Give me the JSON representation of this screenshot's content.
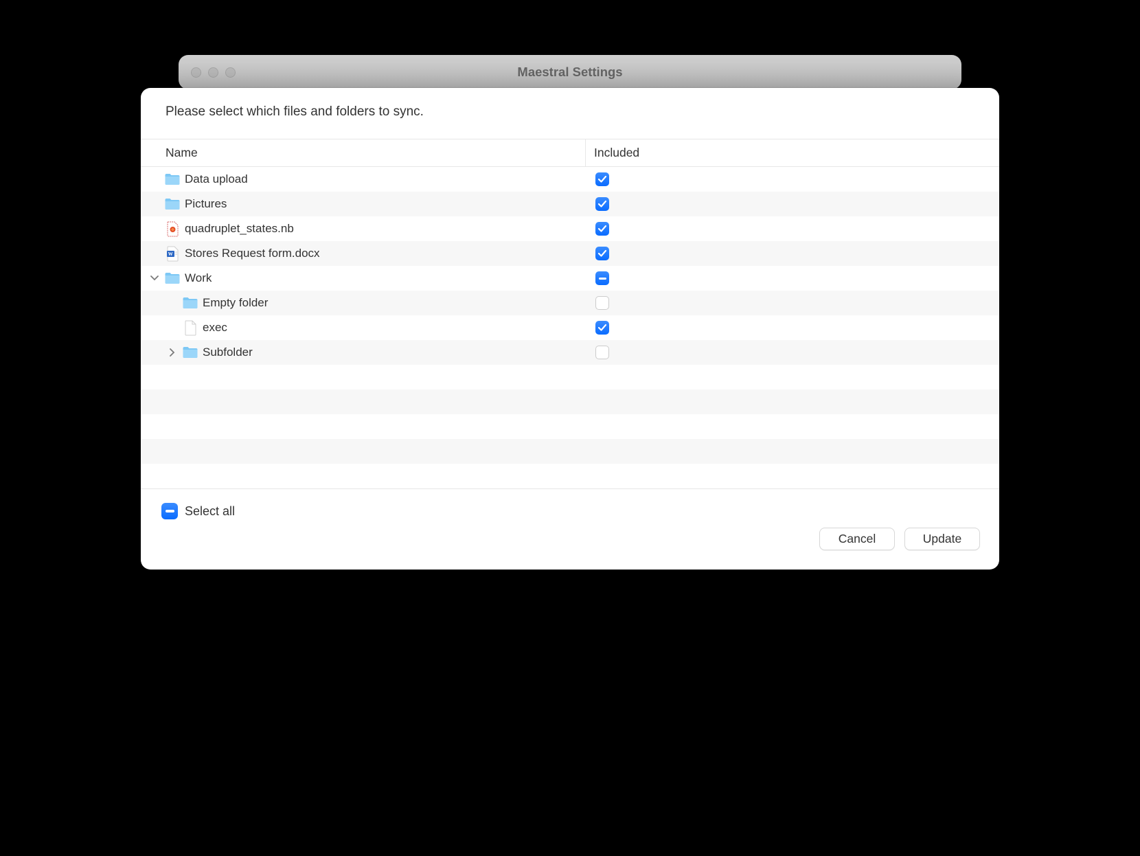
{
  "window": {
    "title": "Maestral Settings"
  },
  "dialog": {
    "instruction": "Please select which files and folders to sync.",
    "columns": {
      "name": "Name",
      "included": "Included"
    },
    "select_all_label": "Select all",
    "select_all_state": "mixed",
    "buttons": {
      "cancel": "Cancel",
      "update": "Update"
    },
    "items": [
      {
        "name": "Data upload",
        "icon": "folder",
        "indent": 0,
        "disclosure": null,
        "state": "checked"
      },
      {
        "name": "Pictures",
        "icon": "folder",
        "indent": 0,
        "disclosure": null,
        "state": "checked"
      },
      {
        "name": "quadruplet_states.nb",
        "icon": "nb",
        "indent": 0,
        "disclosure": null,
        "state": "checked"
      },
      {
        "name": "Stores Request form.docx",
        "icon": "docx",
        "indent": 0,
        "disclosure": null,
        "state": "checked"
      },
      {
        "name": "Work",
        "icon": "folder",
        "indent": 0,
        "disclosure": "open",
        "state": "mixed"
      },
      {
        "name": "Empty folder",
        "icon": "folder",
        "indent": 1,
        "disclosure": null,
        "state": "unchecked"
      },
      {
        "name": "exec",
        "icon": "blank",
        "indent": 1,
        "disclosure": null,
        "state": "checked"
      },
      {
        "name": "Subfolder",
        "icon": "folder",
        "indent": 1,
        "disclosure": "closed",
        "state": "unchecked"
      }
    ],
    "empty_rows": 5
  }
}
